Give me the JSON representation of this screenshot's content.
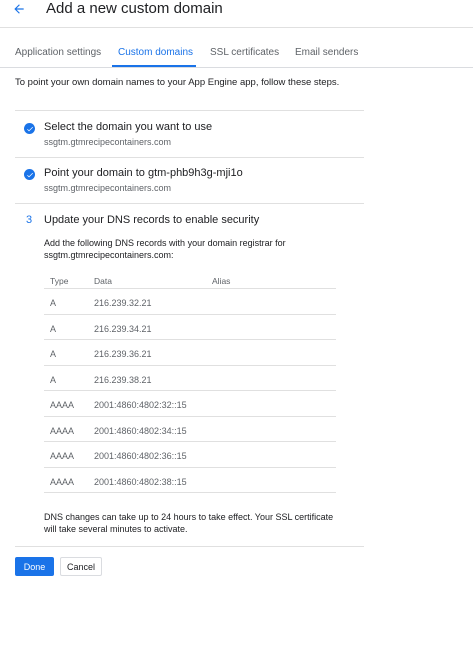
{
  "header": {
    "title": "Add a new custom domain",
    "back_icon": "arrow-back-icon"
  },
  "tabs": [
    {
      "label": "Application settings",
      "active": false
    },
    {
      "label": "Custom domains",
      "active": true
    },
    {
      "label": "SSL certificates",
      "active": false
    },
    {
      "label": "Email senders",
      "active": false
    }
  ],
  "intro": "To point your own domain names to your App Engine app, follow these steps.",
  "steps": [
    {
      "title": "Select the domain you want to use",
      "subtitle": "ssgtm.gtmrecipecontainers.com",
      "status": "done"
    },
    {
      "title": "Point your domain to gtm-phb9h3g-mji1o",
      "subtitle": "ssgtm.gtmrecipecontainers.com",
      "status": "done"
    },
    {
      "number": "3",
      "title": "Update your DNS records to enable security",
      "status": "current"
    }
  ],
  "instructions": "Add the following DNS records with your domain registrar for ssgtm.gtmrecipecontainers.com:",
  "dns_table": {
    "headers": [
      "Type",
      "Data",
      "Alias"
    ],
    "rows": [
      {
        "type": "A",
        "data": "216.239.32.21",
        "alias": ""
      },
      {
        "type": "A",
        "data": "216.239.34.21",
        "alias": ""
      },
      {
        "type": "A",
        "data": "216.239.36.21",
        "alias": ""
      },
      {
        "type": "A",
        "data": "216.239.38.21",
        "alias": ""
      },
      {
        "type": "AAAA",
        "data": "2001:4860:4802:32::15",
        "alias": ""
      },
      {
        "type": "AAAA",
        "data": "2001:4860:4802:34::15",
        "alias": ""
      },
      {
        "type": "AAAA",
        "data": "2001:4860:4802:36::15",
        "alias": ""
      },
      {
        "type": "AAAA",
        "data": "2001:4860:4802:38::15",
        "alias": ""
      }
    ]
  },
  "note": "DNS changes can take up to 24 hours to take effect. Your SSL certificate will take several minutes to activate.",
  "buttons": {
    "done": "Done",
    "cancel": "Cancel"
  },
  "colors": {
    "accent": "#1a73e8",
    "text": "#202124",
    "secondary_text": "#5f6368",
    "divider": "#e0e0e0"
  }
}
